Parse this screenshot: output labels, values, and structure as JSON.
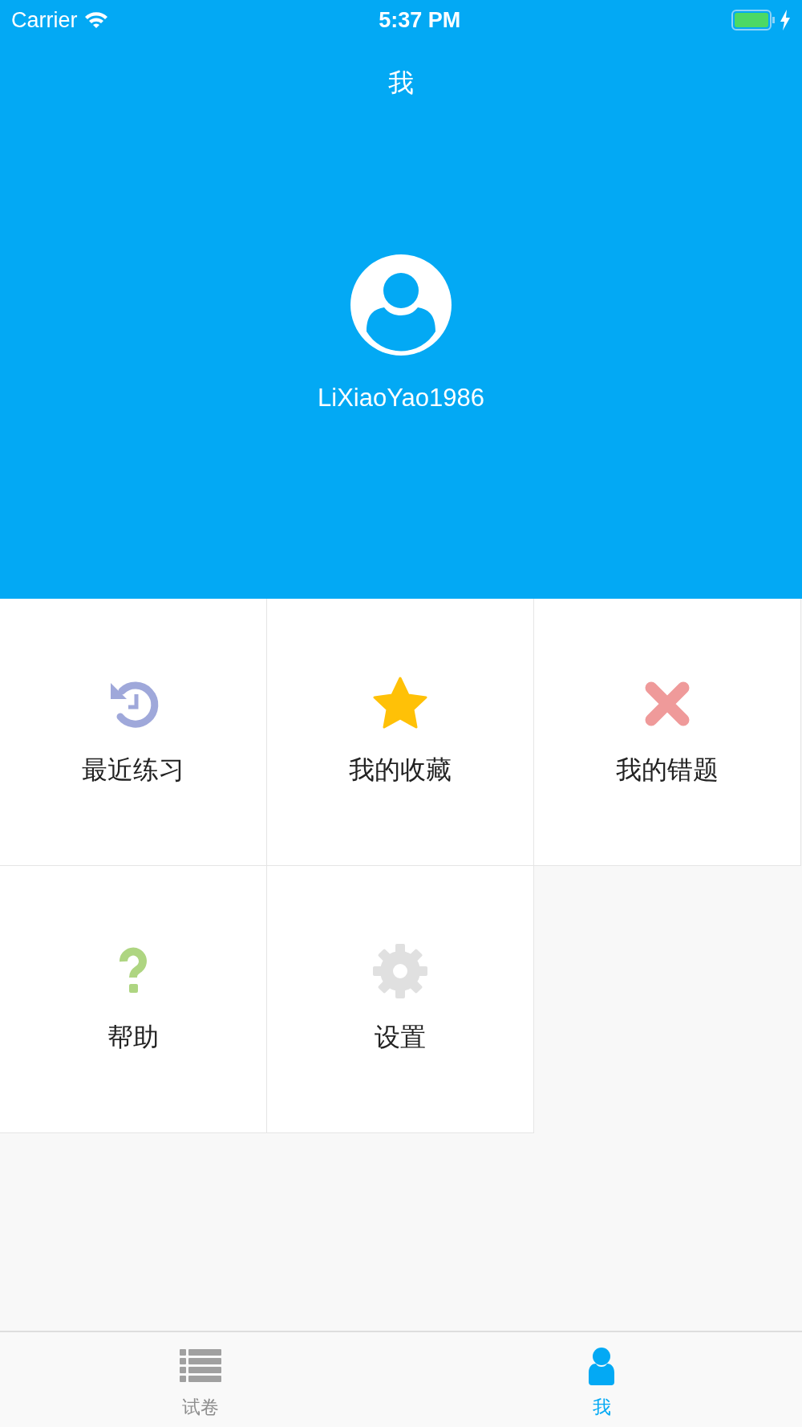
{
  "status_bar": {
    "carrier": "Carrier",
    "time": "5:37 PM"
  },
  "nav_bar": {
    "title": "我"
  },
  "profile": {
    "username": "LiXiaoYao1986"
  },
  "menu": [
    {
      "kind": "history",
      "label": "最近练习",
      "color": "#9fa8da"
    },
    {
      "kind": "star",
      "label": "我的收藏",
      "color": "#ffc107"
    },
    {
      "kind": "cross",
      "label": "我的错题",
      "color": "#ef9a9a"
    },
    {
      "kind": "help",
      "label": "帮助",
      "color": "#aed581"
    },
    {
      "kind": "settings",
      "label": "设置",
      "color": "#e0e0e0"
    }
  ],
  "tab_bar": [
    {
      "kind": "papers",
      "label": "试卷",
      "selected": false
    },
    {
      "kind": "me",
      "label": "我",
      "selected": true
    }
  ]
}
